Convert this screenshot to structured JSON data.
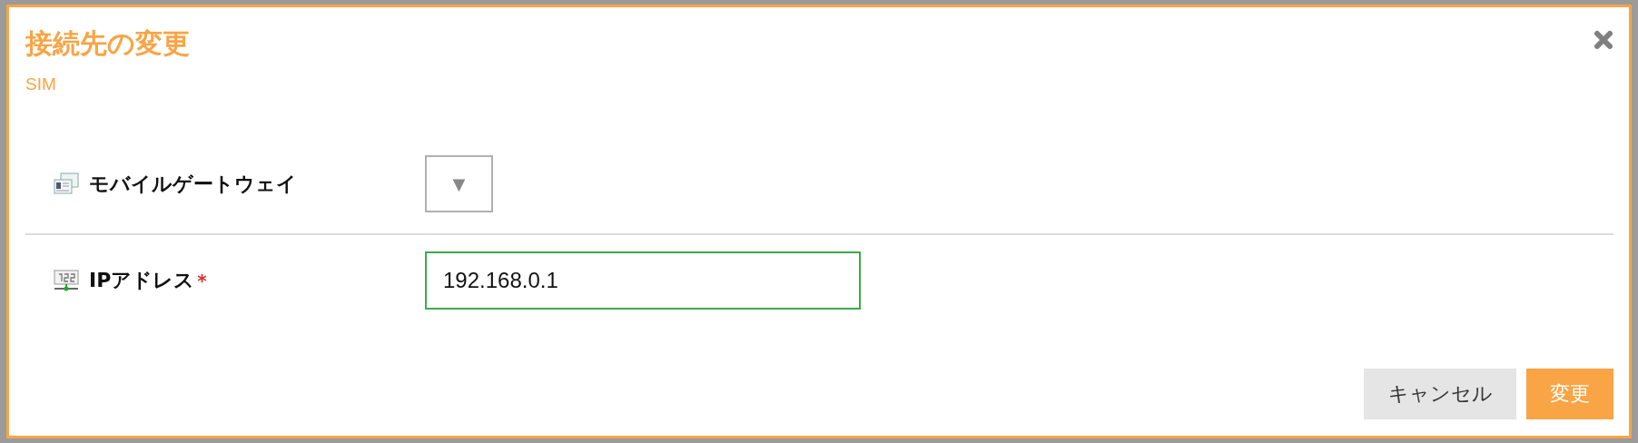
{
  "dialog": {
    "title": "接続先の変更",
    "subtitle": "SIM",
    "fields": [
      {
        "kind": "select",
        "label": "モバイルゲートウェイ",
        "arrow": "▼"
      },
      {
        "kind": "text",
        "label": "IPアドレス",
        "required_mark": "*",
        "value": "192.168.0.1",
        "focused": true
      }
    ],
    "buttons": [
      {
        "label": "キャンセル",
        "kind": "secondary"
      },
      {
        "label": "変更",
        "kind": "primary"
      }
    ]
  }
}
